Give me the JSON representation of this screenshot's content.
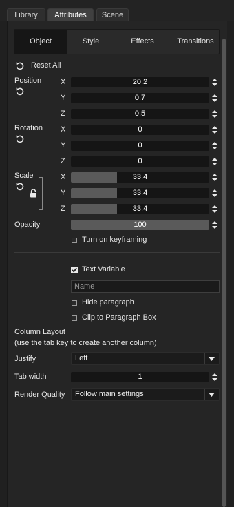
{
  "top_tabs": [
    {
      "label": "Library",
      "active": false
    },
    {
      "label": "Attributes",
      "active": true
    },
    {
      "label": "Scene",
      "active": false
    }
  ],
  "sub_tabs": [
    {
      "label": "Object",
      "active": true
    },
    {
      "label": "Style",
      "active": false
    },
    {
      "label": "Effects",
      "active": false
    },
    {
      "label": "Transitions",
      "active": false
    }
  ],
  "reset_all": "Reset All",
  "position": {
    "label": "Position",
    "x": "20.2",
    "y": "0.7",
    "z": "0.5"
  },
  "rotation": {
    "label": "Rotation",
    "x": "0",
    "y": "0",
    "z": "0"
  },
  "scale": {
    "label": "Scale",
    "x": "33.4",
    "y": "33.4",
    "z": "33.4",
    "fill_fraction": 0.334
  },
  "axes": {
    "x": "X",
    "y": "Y",
    "z": "Z"
  },
  "opacity": {
    "label": "Opacity",
    "value": "100",
    "fill_fraction": 1.0
  },
  "keyframing": {
    "label": "Turn on keyframing",
    "checked": false
  },
  "text_variable": {
    "label": "Text Variable",
    "checked": true
  },
  "name_field": {
    "placeholder": "Name",
    "value": ""
  },
  "hide_paragraph": {
    "label": "Hide paragraph",
    "checked": false
  },
  "clip_paragraph": {
    "label": "Clip to Paragraph Box",
    "checked": false
  },
  "column_layout": {
    "title": "Column Layout",
    "hint": "(use the tab key to create another column)"
  },
  "justify": {
    "label": "Justify",
    "value": "Left"
  },
  "tab_width": {
    "label": "Tab width",
    "value": "1"
  },
  "render_quality": {
    "label": "Render Quality",
    "value": "Follow main settings"
  },
  "colors": {
    "background": "#202020",
    "field": "#151515",
    "fill": "#5a5a5a",
    "text": "#e8e8e8"
  }
}
